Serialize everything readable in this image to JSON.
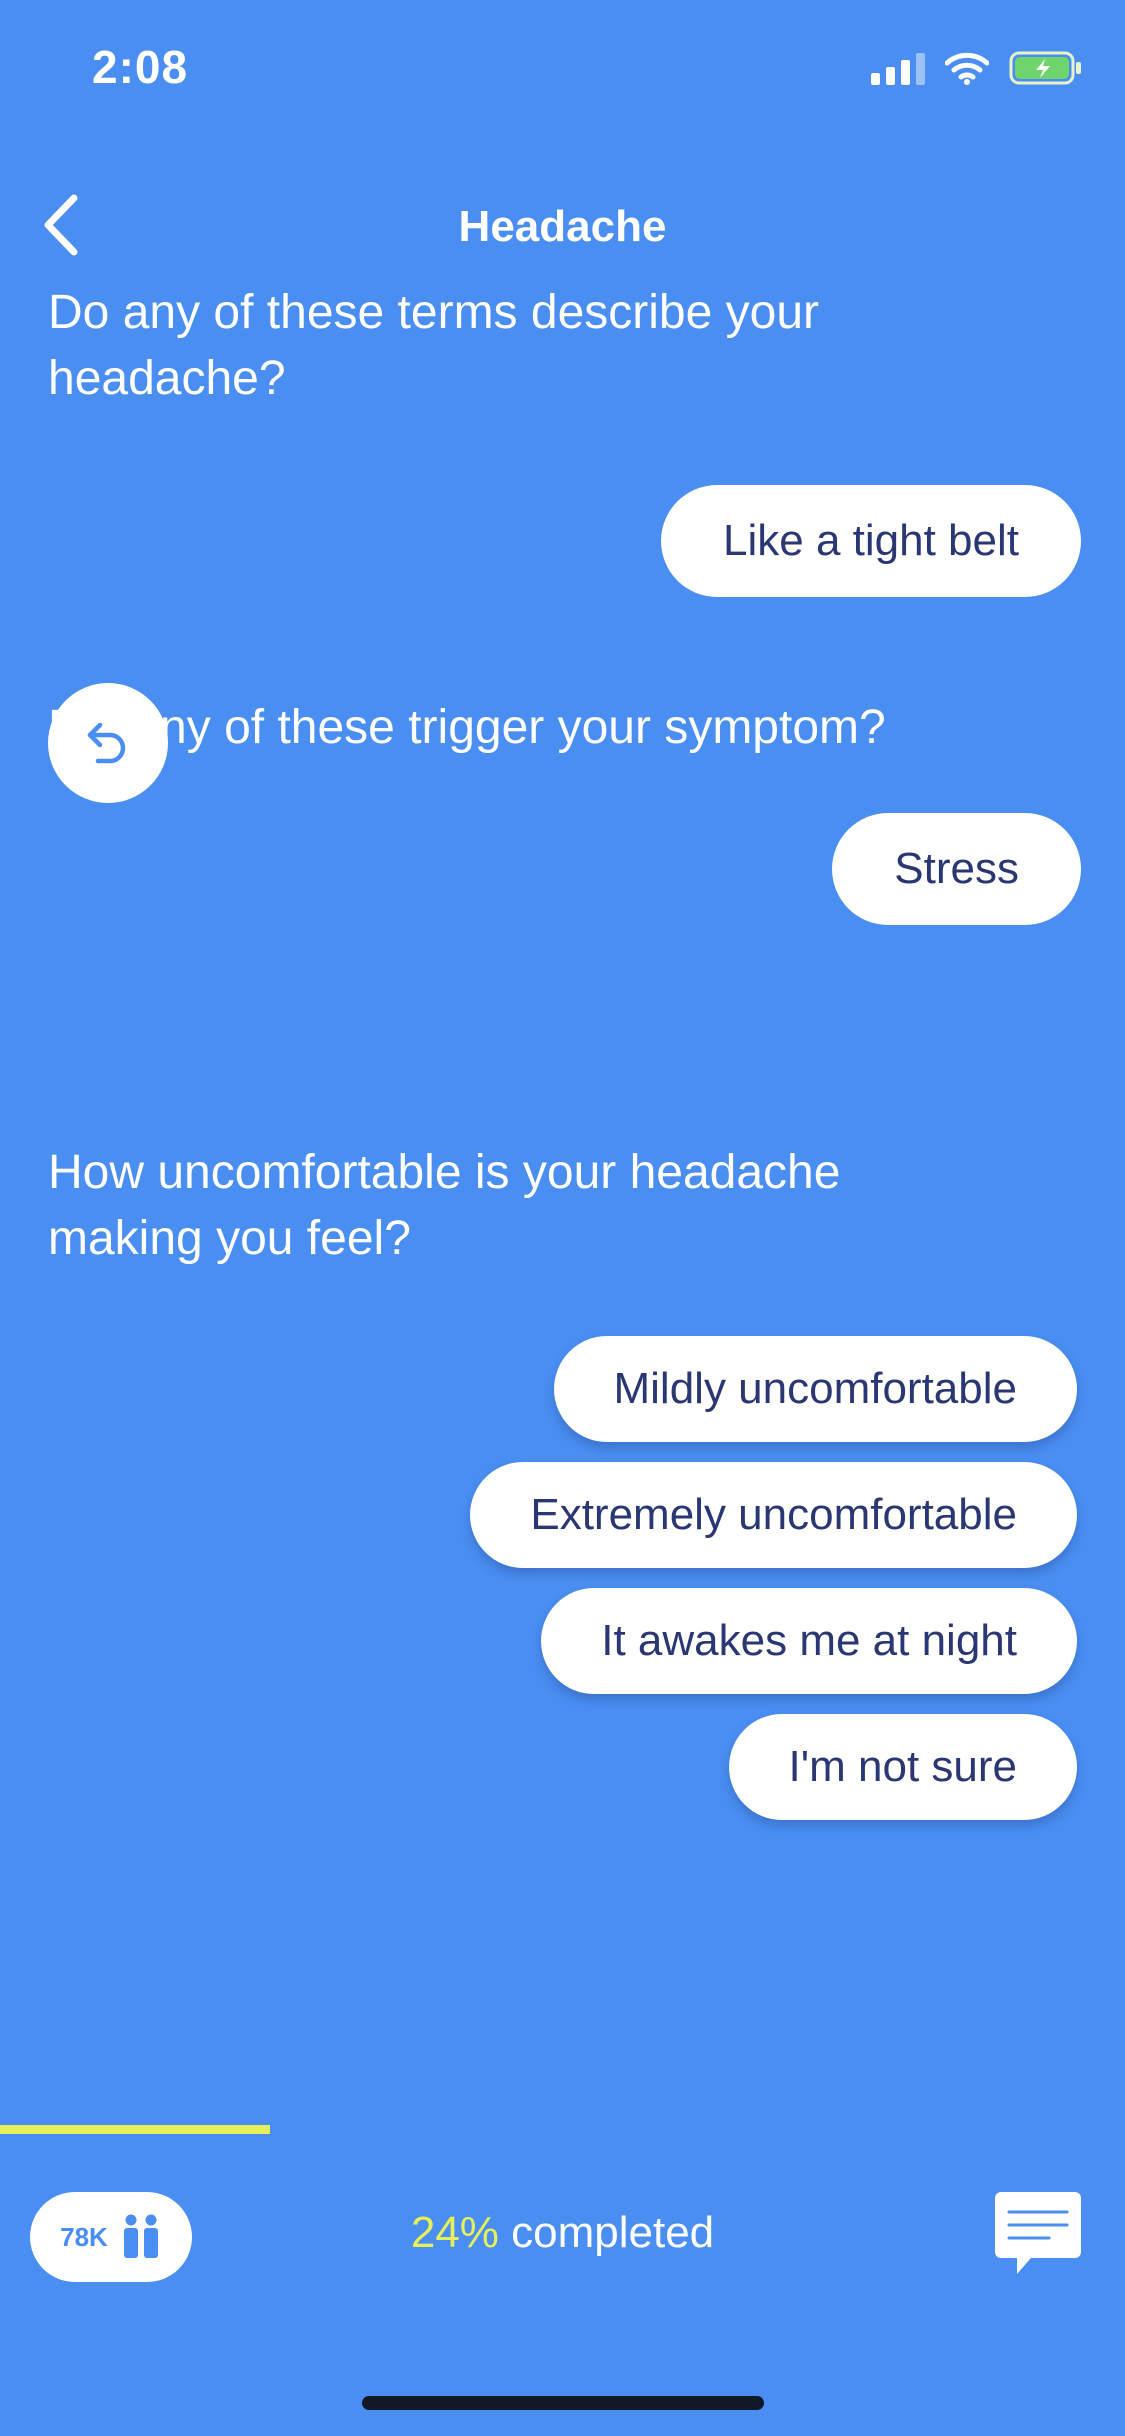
{
  "status_bar": {
    "time": "2:08"
  },
  "nav": {
    "title": "Headache"
  },
  "conversation": {
    "q1": "Do any of these terms describe your headache?",
    "a1": "Like a tight belt",
    "q2": "Did any of these trigger your symptom?",
    "a2": "Stress",
    "q3": "How uncomfortable is your headache making you feel?",
    "options": [
      "Mildly uncomfortable",
      "Extremely uncomfortable",
      "It awakes me at night",
      "I'm not sure"
    ]
  },
  "progress": {
    "percent_label": "24%",
    "completed_label": " completed",
    "fraction": 0.24
  },
  "bottom": {
    "users_count": "78K"
  },
  "colors": {
    "background": "#4a8ef2",
    "accent_yellow": "#e6f05a",
    "bubble_text": "#2b3674"
  },
  "icons": [
    "back-chevron-icon",
    "undo-icon",
    "users-icon",
    "chat-icon",
    "signal-icon",
    "wifi-icon",
    "battery-icon"
  ]
}
